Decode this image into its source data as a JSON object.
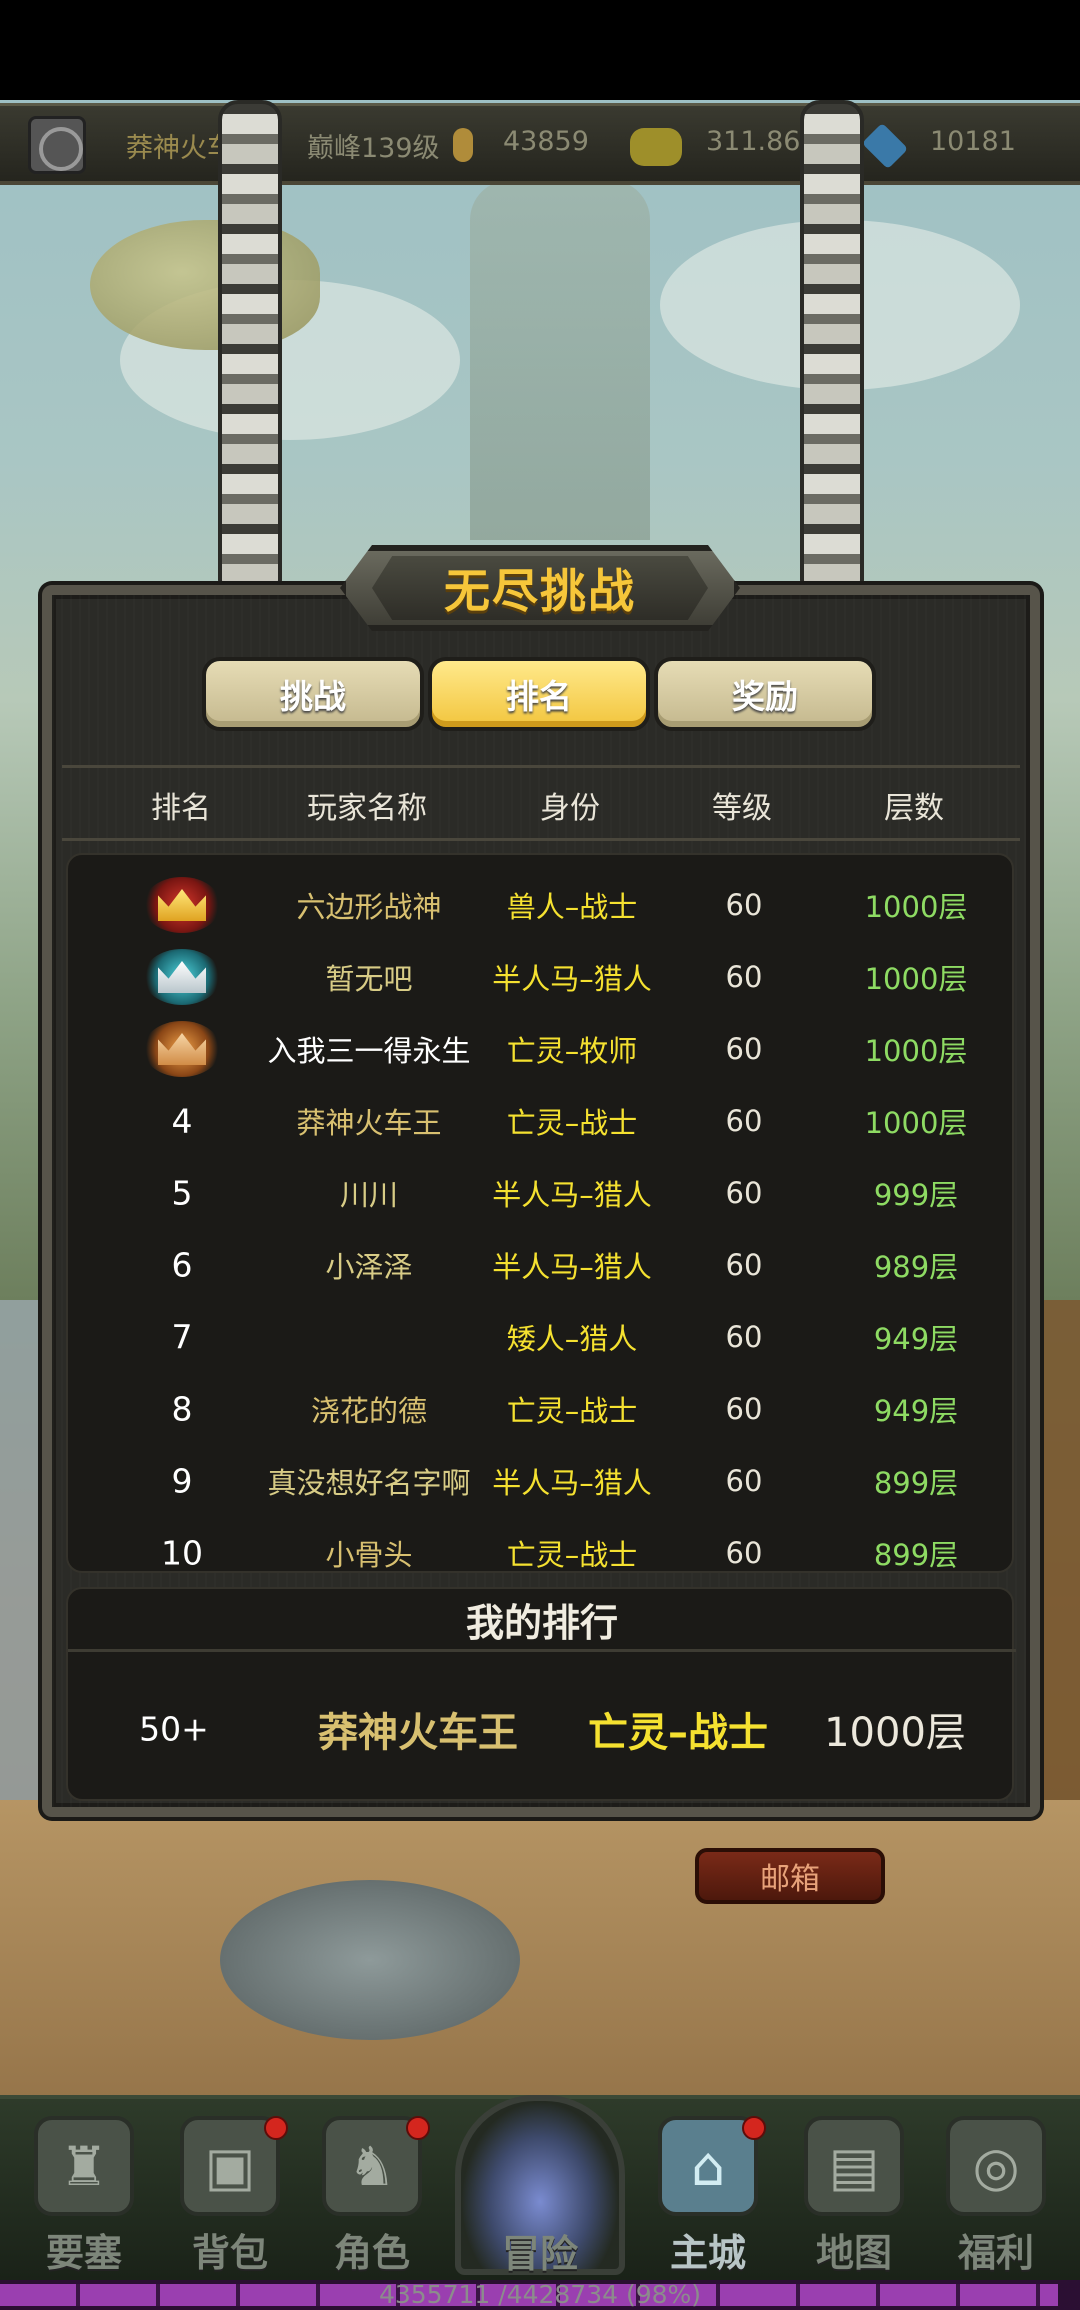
{
  "resource_bar": {
    "player_name": "莽神火车",
    "peak_level": "巅峰139级",
    "power": "43859",
    "gold": "311.86",
    "diamonds": "10181"
  },
  "panel": {
    "title": "无尽挑战",
    "tabs": [
      {
        "label": "挑战",
        "active": false
      },
      {
        "label": "排名",
        "active": true
      },
      {
        "label": "奖励",
        "active": false
      }
    ],
    "headers": [
      "排名",
      "玩家名称",
      "身份",
      "等级",
      "层数"
    ]
  },
  "ranking": [
    {
      "rank": "1",
      "medal": "gold-crown-icon",
      "name": "六边形战神",
      "role": "兽人–战士",
      "level": "60",
      "floor": "1000层"
    },
    {
      "rank": "2",
      "medal": "silver-crown-icon",
      "name": "暂无吧",
      "role": "半人马–猎人",
      "level": "60",
      "floor": "1000层"
    },
    {
      "rank": "3",
      "medal": "bronze-crown-icon",
      "name": "入我三一得永生",
      "role": "亡灵–牧师",
      "level": "60",
      "floor": "1000层"
    },
    {
      "rank": "4",
      "name": "莽神火车王",
      "role": "亡灵–战士",
      "level": "60",
      "floor": "1000层"
    },
    {
      "rank": "5",
      "name": "川川",
      "role": "半人马–猎人",
      "level": "60",
      "floor": "999层"
    },
    {
      "rank": "6",
      "name": "小泽泽",
      "role": "半人马–猎人",
      "level": "60",
      "floor": "989层"
    },
    {
      "rank": "7",
      "name": "",
      "role": "矮人–猎人",
      "level": "60",
      "floor": "949层"
    },
    {
      "rank": "8",
      "name": "浇花的德",
      "role": "亡灵–战士",
      "level": "60",
      "floor": "949层"
    },
    {
      "rank": "9",
      "name": "真没想好名字啊",
      "role": "半人马–猎人",
      "level": "60",
      "floor": "899层"
    },
    {
      "rank": "10",
      "name": "小骨头",
      "role": "亡灵–战士",
      "level": "60",
      "floor": "899层"
    }
  ],
  "my_rank": {
    "title": "我的排行",
    "rank": "50+",
    "name": "莽神火车王",
    "role": "亡灵–战士",
    "floor": "1000层"
  },
  "mailbox_label": "邮箱",
  "bottom_nav": [
    {
      "label": "要塞",
      "icon": "fortress-icon",
      "badge": false
    },
    {
      "label": "背包",
      "icon": "backpack-icon",
      "badge": true
    },
    {
      "label": "角色",
      "icon": "helmet-icon",
      "badge": true
    },
    {
      "label": "冒险",
      "icon": "portal-icon",
      "badge": false
    },
    {
      "label": "主城",
      "icon": "castle-icon",
      "badge": true,
      "active": true
    },
    {
      "label": "地图",
      "icon": "scroll-map-icon",
      "badge": false
    },
    {
      "label": "福利",
      "icon": "gift-icon",
      "badge": false
    }
  ],
  "experience": {
    "text": "4355711 /4428734 (98%)",
    "fraction": 0.98
  },
  "colors": {
    "accent_gold": "#f6c63a",
    "role_yellow": "#f5e130",
    "floor_green": "#8edb63",
    "badge_red": "#d4261e"
  }
}
